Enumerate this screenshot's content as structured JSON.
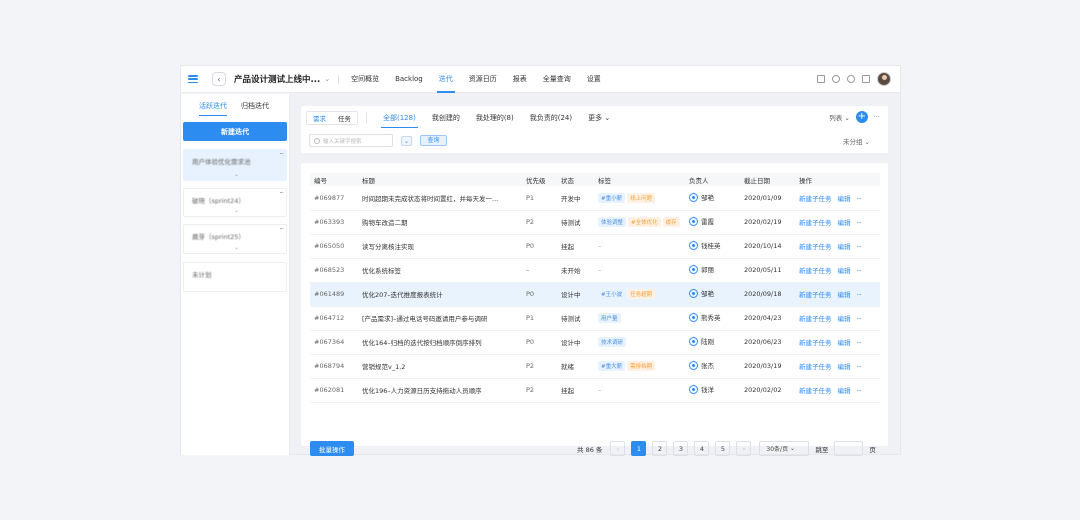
{
  "header": {
    "project_title": "产品设计测试上线中...",
    "nav": [
      "空间概览",
      "Backlog",
      "迭代",
      "资源日历",
      "报表",
      "全量查询",
      "设置"
    ],
    "active_nav": "迭代"
  },
  "sidebar": {
    "tabs": [
      "活跃迭代",
      "归档迭代"
    ],
    "new_button": "新建迭代",
    "iterations": [
      {
        "label": "用户体验优化需求池"
      },
      {
        "label": "破晓（sprint24）"
      },
      {
        "label": "晨芽（sprint25）"
      },
      {
        "label": "未计划"
      }
    ]
  },
  "filter": {
    "type_seg": [
      "需求",
      "任务"
    ],
    "tabs": [
      "全部(128)",
      "我创建的",
      "我处理的(8)",
      "我负责的(24)",
      "更多"
    ],
    "view": "列表",
    "search_placeholder": "输入关键字搜索",
    "query_button": "查询",
    "group": "未分组"
  },
  "table": {
    "columns": [
      "编号",
      "标题",
      "优先级",
      "状态",
      "标签",
      "负责人",
      "截止日期",
      "操作"
    ],
    "actions": [
      "新建子任务",
      "编辑"
    ],
    "rows": [
      {
        "id": "#069877",
        "title": "时间超期未完成状态将时间置红，并每天发一...",
        "priority": "P1",
        "status": "开发中",
        "tags": [
          {
            "t": "#重小薪",
            "c": "tb"
          },
          {
            "t": "线上问题",
            "c": "to"
          }
        ],
        "owner": "邹艳",
        "due": "2020/01/09"
      },
      {
        "id": "#063393",
        "title": "购物车改造二期",
        "priority": "P2",
        "status": "待测试",
        "tags": [
          {
            "t": "体验调整",
            "c": "tb"
          },
          {
            "t": "#全体优化",
            "c": "to"
          },
          {
            "t": "缓存",
            "c": "to"
          }
        ],
        "owner": "雷霞",
        "due": "2020/02/19"
      },
      {
        "id": "#065050",
        "title": "读写分离核注实现",
        "priority": "P0",
        "status": "挂起",
        "tags": [],
        "owner": "钱桂英",
        "due": "2020/10/14"
      },
      {
        "id": "#068523",
        "title": "优化系统标签",
        "priority": "–",
        "status": "未开始",
        "tags": [],
        "owner": "郭丽",
        "due": "2020/05/11"
      },
      {
        "id": "#061489",
        "title": "优化207–迭代推度报表统计",
        "priority": "P0",
        "status": "设计中",
        "tags": [
          {
            "t": "#王小波",
            "c": "tb"
          },
          {
            "t": "任务超期",
            "c": "to"
          }
        ],
        "owner": "邹艳",
        "due": "2020/09/18"
      },
      {
        "id": "#064712",
        "title": "[产品需求]–通过电话号码邀请用户参与调研",
        "priority": "P1",
        "status": "待测试",
        "tags": [
          {
            "t": "用户量",
            "c": "tb"
          }
        ],
        "owner": "熊秀英",
        "due": "2020/04/23"
      },
      {
        "id": "#067364",
        "title": "优化164–归档的迭代按归档顺序倒序排列",
        "priority": "P0",
        "status": "设计中",
        "tags": [
          {
            "t": "技术调研",
            "c": "tb"
          }
        ],
        "owner": "陆刚",
        "due": "2020/06/23"
      },
      {
        "id": "#068794",
        "title": "营销规范v_1.2",
        "priority": "P2",
        "status": "就绪",
        "tags": [
          {
            "t": "#重大薪",
            "c": "tb"
          },
          {
            "t": "需排档期",
            "c": "to"
          }
        ],
        "owner": "张杰",
        "due": "2020/03/19"
      },
      {
        "id": "#062081",
        "title": "优化196–人力资源日历支持拖动人员顺序",
        "priority": "P2",
        "status": "挂起",
        "tags": [],
        "owner": "钱洋",
        "due": "2020/02/02"
      }
    ]
  },
  "footer": {
    "batch_button": "批量操作",
    "total": "共 86 条",
    "pages": [
      "1",
      "2",
      "3",
      "4",
      "5"
    ],
    "page_size": "30条/页",
    "jump_label": "跳至",
    "page_suffix": "页"
  }
}
